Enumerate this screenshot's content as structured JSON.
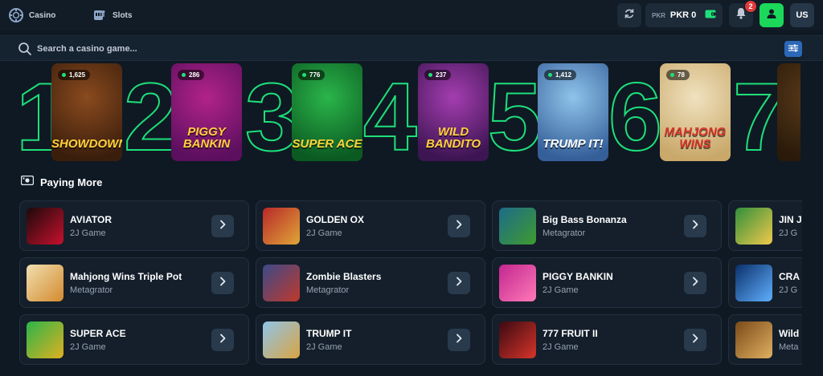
{
  "nav": {
    "casino_label": "Casino",
    "slots_label": "Slots"
  },
  "header": {
    "currency_code": "PKR",
    "balance": "PKR 0",
    "notification_count": "2",
    "language": "US"
  },
  "search": {
    "placeholder": "Search a casino game..."
  },
  "top_games": [
    {
      "rank": "1",
      "count": "1,625",
      "title_art": "SHOWDOWN",
      "colors": [
        "#8a4a1e",
        "#3a1e0c"
      ],
      "art_icon": "cowgirl-art"
    },
    {
      "rank": "2",
      "count": "286",
      "title_art": "PIGGY BANKIN",
      "colors": [
        "#b2238a",
        "#5b0f5e"
      ],
      "art_icon": "piggy-bank-art"
    },
    {
      "rank": "3",
      "count": "776",
      "title_art": "SUPER ACE",
      "colors": [
        "#2bb54a",
        "#0b5a22"
      ],
      "art_icon": "jester-crown-art"
    },
    {
      "rank": "4",
      "count": "237",
      "title_art": "WILD BANDITO",
      "colors": [
        "#a43db0",
        "#3d1552"
      ],
      "art_icon": "skull-bandit-art"
    },
    {
      "rank": "5",
      "count": "1,412",
      "title_art": "TRUMP IT!",
      "colors": [
        "#8fc4ea",
        "#355f99"
      ],
      "art_icon": "cartoon-president-art"
    },
    {
      "rank": "6",
      "count": "78",
      "title_art": "MAHJONG WINS",
      "colors": [
        "#f0e2bf",
        "#c9a86a"
      ],
      "art_icon": "mahjong-tiles-art"
    },
    {
      "rank": "7",
      "count": "",
      "title_art": "",
      "colors": [
        "#5a3a1a",
        "#2a1a0a"
      ],
      "art_icon": "partial-card-art"
    }
  ],
  "section": {
    "title": "Paying More"
  },
  "games": [
    {
      "name": "AVIATOR",
      "provider": "2J Game",
      "colors": [
        "#1a0a0a",
        "#c8102e"
      ]
    },
    {
      "name": "GOLDEN OX",
      "provider": "2J Game",
      "colors": [
        "#b8282a",
        "#e0a637"
      ]
    },
    {
      "name": "Big Bass Bonanza",
      "provider": "Metagrator",
      "colors": [
        "#1d6b8a",
        "#3f9b2e"
      ]
    },
    {
      "name": "JIN J",
      "provider": "2J G",
      "colors": [
        "#2f8f3a",
        "#f2c94c"
      ]
    },
    {
      "name": "Mahjong Wins Triple Pot",
      "provider": "Metagrator",
      "colors": [
        "#f0dfb0",
        "#d48a2e"
      ]
    },
    {
      "name": "Zombie Blasters",
      "provider": "Metagrator",
      "colors": [
        "#3b4a8a",
        "#c0392b"
      ]
    },
    {
      "name": "PIGGY BANKIN",
      "provider": "2J Game",
      "colors": [
        "#c2268f",
        "#ff7ab8"
      ]
    },
    {
      "name": "CRA",
      "provider": "2J G",
      "colors": [
        "#0b2f6a",
        "#5fb0ff"
      ]
    },
    {
      "name": "SUPER ACE",
      "provider": "2J Game",
      "colors": [
        "#2bb54a",
        "#e0b020"
      ]
    },
    {
      "name": "TRUMP IT",
      "provider": "2J Game",
      "colors": [
        "#8fc4ea",
        "#d9a441"
      ]
    },
    {
      "name": "777 FRUIT II",
      "provider": "2J Game",
      "colors": [
        "#3a0a12",
        "#d8342a"
      ]
    },
    {
      "name": "Wild",
      "provider": "Meta",
      "colors": [
        "#7a4a1a",
        "#e0b060"
      ]
    }
  ],
  "colors": {
    "accent_green": "#1ee07a",
    "user_button": "#1bd85b",
    "filter_button": "#2c68b8",
    "badge_red": "#e23b3b"
  }
}
